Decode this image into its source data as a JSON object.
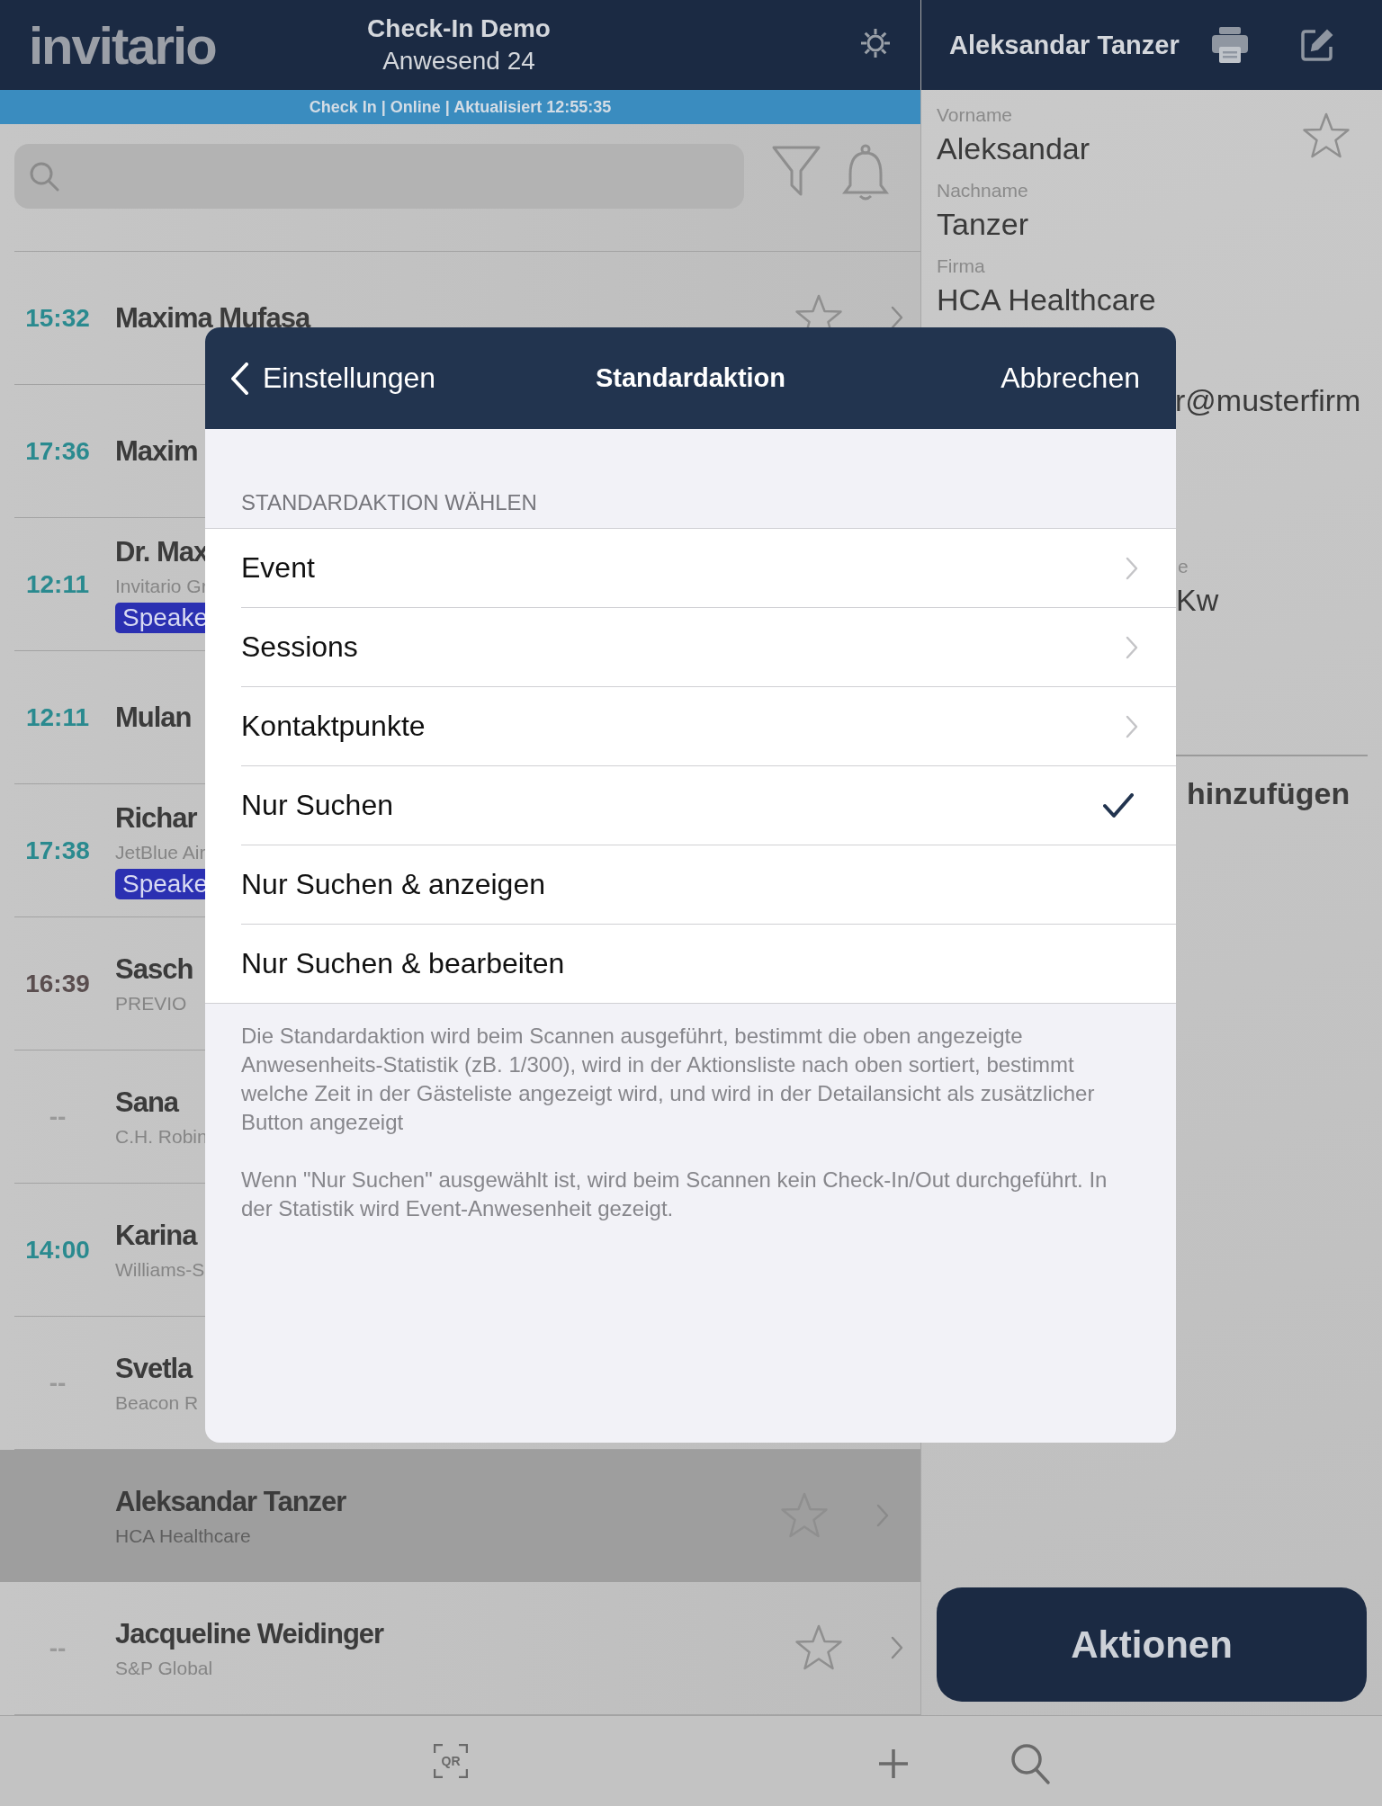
{
  "header": {
    "logo": "invitario",
    "event_title": "Check-In Demo",
    "attendance": "Anwesend 24"
  },
  "status_strip": "Check In | Online | Aktualisiert 12:55:35",
  "guests": [
    {
      "time": "15:32",
      "color": "#2a8a8f",
      "name": "Maxima Mufasa",
      "selected": false
    },
    {
      "time": "17:36",
      "color": "#2a8a8f",
      "name": "Maxim",
      "selected": false
    },
    {
      "time": "12:11",
      "color": "#2a8a8f",
      "name": "Dr. Max",
      "company": "Invitario Gr",
      "badge": "Speake",
      "selected": false
    },
    {
      "time": "12:11",
      "color": "#2a8a8f",
      "name": "Mulan",
      "selected": false
    },
    {
      "time": "17:38",
      "color": "#2a8a8f",
      "name": "Richar",
      "company": "JetBlue Air",
      "badge": "Speake",
      "selected": false
    },
    {
      "time": "16:39",
      "color": "#5a4e4f",
      "name": "Sasch",
      "company": "PREVIO",
      "selected": false
    },
    {
      "time": "--",
      "color": "#9a9a9a",
      "name": "Sana",
      "company": "C.H. Robin",
      "selected": false
    },
    {
      "time": "14:00",
      "color": "#2a8a8f",
      "name": "Karina",
      "company": "Williams-S",
      "selected": false
    },
    {
      "time": "--",
      "color": "#9a9a9a",
      "name": "Svetla",
      "company": "Beacon R",
      "selected": false
    },
    {
      "name": "Aleksandar Tanzer",
      "company": "HCA Healthcare",
      "selected": true
    },
    {
      "time": "--",
      "color": "#9a9a9a",
      "name": "Jacqueline Weidinger",
      "company": "S&P Global",
      "selected": false
    }
  ],
  "detail": {
    "title": "Aleksandar Tanzer",
    "fields": [
      {
        "label": "Vorname",
        "value": "Aleksandar"
      },
      {
        "label": "Nachname",
        "value": "Tanzer"
      },
      {
        "label": "Firma",
        "value": "HCA Healthcare"
      }
    ],
    "email_fragment": "r@musterfirm",
    "field_label_fragment": "e",
    "field_value_fragment": "Kw",
    "add_fragment": "hinzufügen",
    "actions_button": "Aktionen"
  },
  "modal": {
    "back": "Einstellungen",
    "title": "Standardaktion",
    "cancel": "Abbrechen",
    "section": "STANDARDAKTION WÄHLEN",
    "options": [
      {
        "label": "Event",
        "kind": "submenu",
        "selected": false
      },
      {
        "label": "Sessions",
        "kind": "submenu",
        "selected": false
      },
      {
        "label": "Kontaktpunkte",
        "kind": "submenu",
        "selected": false
      },
      {
        "label": "Nur Suchen",
        "kind": "option",
        "selected": true
      },
      {
        "label": "Nur Suchen & anzeigen",
        "kind": "option",
        "selected": false
      },
      {
        "label": "Nur Suchen & bearbeiten",
        "kind": "option",
        "selected": false
      }
    ],
    "notes": [
      "Die Standardaktion wird beim Scannen ausgeführt, bestimmt die oben angezeigte Anwesenheits-Statistik (zB. 1/300), wird in der Aktionsliste nach oben sortiert, bestimmt welche Zeit in der Gästeliste angezeigt wird, und wird in der Detailansicht als zusätzlicher Button angezeigt",
      "Wenn \"Nur Suchen\" ausgewählt ist, wird beim Scannen kein Check-In/Out durchgeführt. In der Statistik wird Event-Anwesenheit gezeigt."
    ]
  },
  "tab_bar": {
    "qr_label": "QR"
  }
}
